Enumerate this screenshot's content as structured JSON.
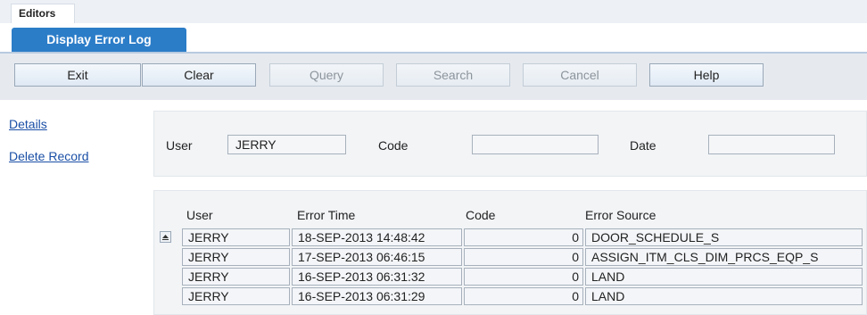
{
  "tabs": {
    "editors": "Editors",
    "screen_title": "Display Error Log"
  },
  "toolbar": {
    "buttons": [
      {
        "label": "Exit",
        "enabled": true
      },
      {
        "label": "Clear",
        "enabled": true
      },
      {
        "label": "Query",
        "enabled": false
      },
      {
        "label": "Search",
        "enabled": false
      },
      {
        "label": "Cancel",
        "enabled": false
      },
      {
        "label": "Help",
        "enabled": true
      }
    ]
  },
  "sidebar": {
    "links": [
      "Details",
      "Delete Record"
    ]
  },
  "filters": {
    "user_label": "User",
    "user_value": "JERRY",
    "code_label": "Code",
    "code_value": "",
    "date_label": "Date",
    "date_value": ""
  },
  "table": {
    "headers": [
      "User",
      "Error Time",
      "Code",
      "Error Source"
    ],
    "rows": [
      {
        "user": "JERRY",
        "time": "18-SEP-2013 14:48:42",
        "code": "0",
        "source": "DOOR_SCHEDULE_S"
      },
      {
        "user": "JERRY",
        "time": "17-SEP-2013 06:46:15",
        "code": "0",
        "source": "ASSIGN_ITM_CLS_DIM_PRCS_EQP_S"
      },
      {
        "user": "JERRY",
        "time": "16-SEP-2013 06:31:32",
        "code": "0",
        "source": "LAND"
      },
      {
        "user": "JERRY",
        "time": "16-SEP-2013 06:31:29",
        "code": "0",
        "source": "LAND"
      }
    ]
  },
  "colors": {
    "accent": "#2c7dc8",
    "link": "#1a4fa6",
    "toolbar_bg": "#e6eaef"
  }
}
